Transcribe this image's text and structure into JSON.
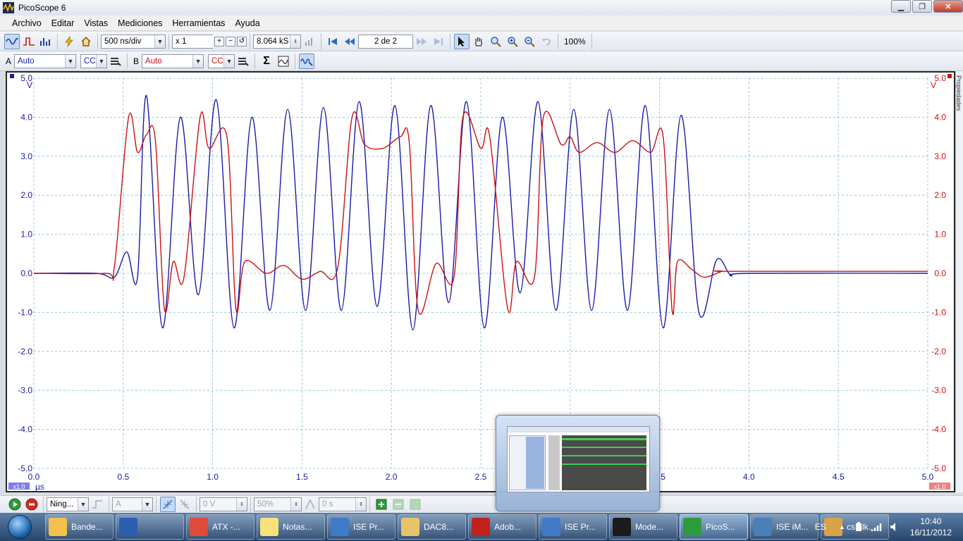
{
  "window": {
    "title": "PicoScope 6"
  },
  "menu": [
    "Archivo",
    "Editar",
    "Vistas",
    "Mediciones",
    "Herramientas",
    "Ayuda"
  ],
  "toolbar": {
    "timebase": "500 ns/div",
    "zoom_factor": "x 1",
    "samples": "8.064 kS",
    "buffer_page": "2 de 2",
    "zoom_percent": "100%"
  },
  "channels": {
    "a": {
      "label": "A",
      "range": "Auto",
      "coupling": "CC",
      "color": "#1a1aa8"
    },
    "b": {
      "label": "B",
      "range": "Auto",
      "coupling": "CC",
      "color": "#cc1111"
    }
  },
  "side_tab": "Propiedades",
  "chart_data": {
    "type": "line",
    "xlabel": "µs",
    "ylabel_left": "V",
    "ylabel_right": "V",
    "xlim": [
      0,
      5
    ],
    "ylim": [
      -5,
      5
    ],
    "x_ticks": [
      "0.0",
      "0.5",
      "1.0",
      "1.5",
      "2.0",
      "2.5",
      "3.0",
      "3.5",
      "4.0",
      "4.5",
      "5.0"
    ],
    "y_ticks": [
      "5.0",
      "4.0",
      "3.0",
      "2.0",
      "1.0",
      "0.0",
      "-1.0",
      "-2.0",
      "-3.0",
      "-4.0",
      "-5.0"
    ],
    "left_scale_badge": "x1.0",
    "right_scale_badge": "x1.0",
    "grid": true,
    "series": [
      {
        "channel": "A",
        "color": "#1a1aa8",
        "x": [
          0.0,
          0.35,
          0.45,
          0.52,
          0.58,
          0.63,
          0.72,
          0.82,
          0.92,
          1.02,
          1.12,
          1.22,
          1.32,
          1.42,
          1.52,
          1.62,
          1.72,
          1.82,
          1.92,
          2.02,
          2.12,
          2.22,
          2.32,
          2.42,
          2.52,
          2.62,
          2.72,
          2.82,
          2.92,
          3.02,
          3.12,
          3.22,
          3.32,
          3.42,
          3.52,
          3.62,
          3.72,
          3.82,
          3.9,
          4.0,
          5.0
        ],
        "y": [
          0.0,
          0.0,
          -0.1,
          0.55,
          -0.1,
          4.55,
          -1.4,
          4.0,
          -0.55,
          4.45,
          -1.4,
          4.0,
          -0.95,
          4.2,
          -0.95,
          4.25,
          -0.95,
          4.4,
          -0.85,
          4.3,
          -1.45,
          4.3,
          -0.75,
          4.4,
          -1.4,
          4.0,
          -0.5,
          4.4,
          -0.95,
          4.2,
          -0.95,
          4.2,
          -0.95,
          4.3,
          -1.4,
          4.05,
          -1.0,
          0.35,
          -0.05,
          0.0,
          0.0
        ]
      },
      {
        "channel": "B",
        "color": "#cc1111",
        "x": [
          0.0,
          0.4,
          0.45,
          0.53,
          0.58,
          0.63,
          0.68,
          0.73,
          0.78,
          0.84,
          0.93,
          0.98,
          1.08,
          1.13,
          1.18,
          1.3,
          1.4,
          1.5,
          1.6,
          1.7,
          1.78,
          1.85,
          1.95,
          2.05,
          2.1,
          2.15,
          2.25,
          2.35,
          2.4,
          2.5,
          2.55,
          2.65,
          2.7,
          2.8,
          2.85,
          2.95,
          3.0,
          3.05,
          3.15,
          3.25,
          3.35,
          3.45,
          3.52,
          3.57,
          3.6,
          3.68,
          3.75,
          3.85,
          3.9,
          5.0
        ],
        "y": [
          0.0,
          0.0,
          0.15,
          4.0,
          3.1,
          3.55,
          3.4,
          -0.9,
          0.3,
          -0.1,
          4.0,
          3.2,
          3.5,
          -0.9,
          0.3,
          0.0,
          0.2,
          -0.15,
          0.05,
          0.15,
          4.0,
          3.3,
          3.2,
          3.5,
          3.35,
          -0.95,
          0.25,
          -0.1,
          4.0,
          3.2,
          3.5,
          -0.9,
          0.3,
          -0.1,
          4.0,
          3.3,
          3.5,
          3.1,
          3.35,
          3.1,
          3.4,
          3.1,
          3.5,
          -0.95,
          0.3,
          0.1,
          -0.1,
          0.05,
          0.05,
          0.05
        ]
      }
    ]
  },
  "bottom": {
    "trigger_mode": "Ning...",
    "trigger_source": "A",
    "trigger_level": "0 V",
    "trigger_pretrigger": "50%",
    "trigger_delay": "0 s"
  },
  "taskbar": {
    "tasks": [
      {
        "label": "Bande...",
        "icon": "outlook-icon",
        "color": "#f2c14e"
      },
      {
        "label": "",
        "icon": "word-icon",
        "color": "#2b5fad"
      },
      {
        "label": "ATX -...",
        "icon": "chrome-icon",
        "color": "#e04a3a"
      },
      {
        "label": "Notas...",
        "icon": "notes-icon",
        "color": "#f7e27a"
      },
      {
        "label": "ISE Pr...",
        "icon": "ise-icon",
        "color": "#3f7bc8"
      },
      {
        "label": "DAC8...",
        "icon": "folder-icon",
        "color": "#e7c46a"
      },
      {
        "label": "Adob...",
        "icon": "adobe-icon",
        "color": "#c0221b"
      },
      {
        "label": "ISE Pr...",
        "icon": "ise-icon",
        "color": "#3f7bc8"
      },
      {
        "label": "Mode...",
        "icon": "modelsim-icon",
        "color": "#1b1b1b"
      },
      {
        "label": "PicoS...",
        "icon": "picoscope-icon",
        "color": "#2e9b3c"
      },
      {
        "label": "ISE iM...",
        "icon": "impact-icon",
        "color": "#4a7fb8"
      },
      {
        "label": "cs-clk...",
        "icon": "paint-icon",
        "color": "#d9a34a"
      }
    ],
    "language": "ES",
    "time": "10:40",
    "date": "16/11/2012"
  }
}
